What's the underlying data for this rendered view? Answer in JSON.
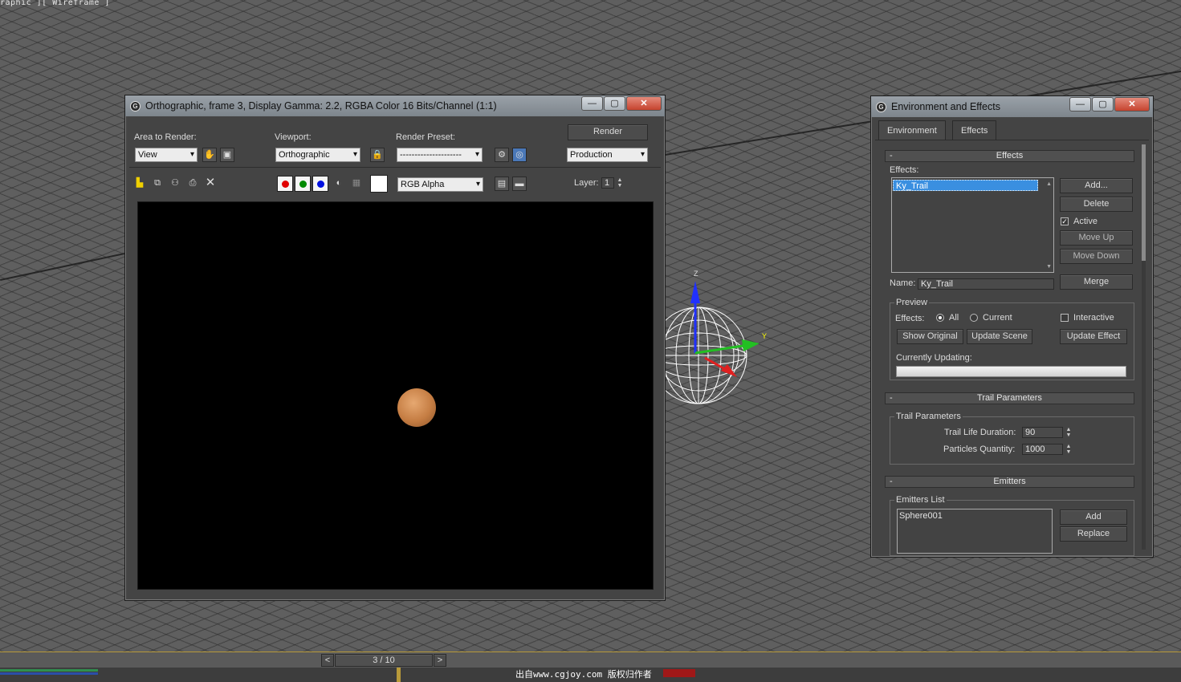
{
  "viewport": {
    "label": "raphic ][ Wireframe ]"
  },
  "render_window": {
    "title": "Orthographic, frame 3, Display Gamma: 2.2, RGBA Color 16 Bits/Channel (1:1)",
    "area_to_render_label": "Area to Render:",
    "area_to_render_value": "View",
    "viewport_label": "Viewport:",
    "viewport_value": "Orthographic",
    "render_preset_label": "Render Preset:",
    "render_preset_value": "---------------------",
    "render_button": "Render",
    "production_value": "Production",
    "channel_value": "RGB Alpha",
    "layer_label": "Layer:",
    "layer_value": "1"
  },
  "env_dialog": {
    "title": "Environment and Effects",
    "tabs": [
      "Environment",
      "Effects"
    ],
    "effects_rollout": {
      "title": "Effects",
      "list_label": "Effects:",
      "list_items": [
        "Ky_Trail"
      ],
      "buttons": {
        "add": "Add...",
        "delete": "Delete",
        "active": "Active",
        "move_up": "Move Up",
        "move_down": "Move Down",
        "merge": "Merge"
      },
      "name_label": "Name:",
      "name_value": "Ky_Trail",
      "preview": {
        "group_label": "Preview",
        "effects_label": "Effects:",
        "all": "All",
        "current": "Current",
        "interactive": "Interactive",
        "show_original": "Show Original",
        "update_scene": "Update Scene",
        "update_effect": "Update Effect",
        "currently_updating": "Currently Updating:"
      }
    },
    "trail_rollout": {
      "title": "Trail Parameters",
      "group_label": "Trail Parameters",
      "life_label": "Trail Life Duration:",
      "life_value": "90",
      "qty_label": "Particles Quantity:",
      "qty_value": "1000"
    },
    "emitters_rollout": {
      "title": "Emitters",
      "group_label": "Emitters List",
      "items": [
        "Sphere001"
      ],
      "add": "Add",
      "replace": "Replace"
    }
  },
  "timeline": {
    "frame": "3 / 10",
    "prev": "<",
    "next": ">"
  },
  "watermark": "出自www.cgjoy.com 版权归作者",
  "gizmo": {
    "axis_y": "Y",
    "axis_z": "Z"
  },
  "colors": {
    "accent_blue": "#3a8fe0",
    "close_red": "#c5432e",
    "ball": "#c57d43"
  }
}
